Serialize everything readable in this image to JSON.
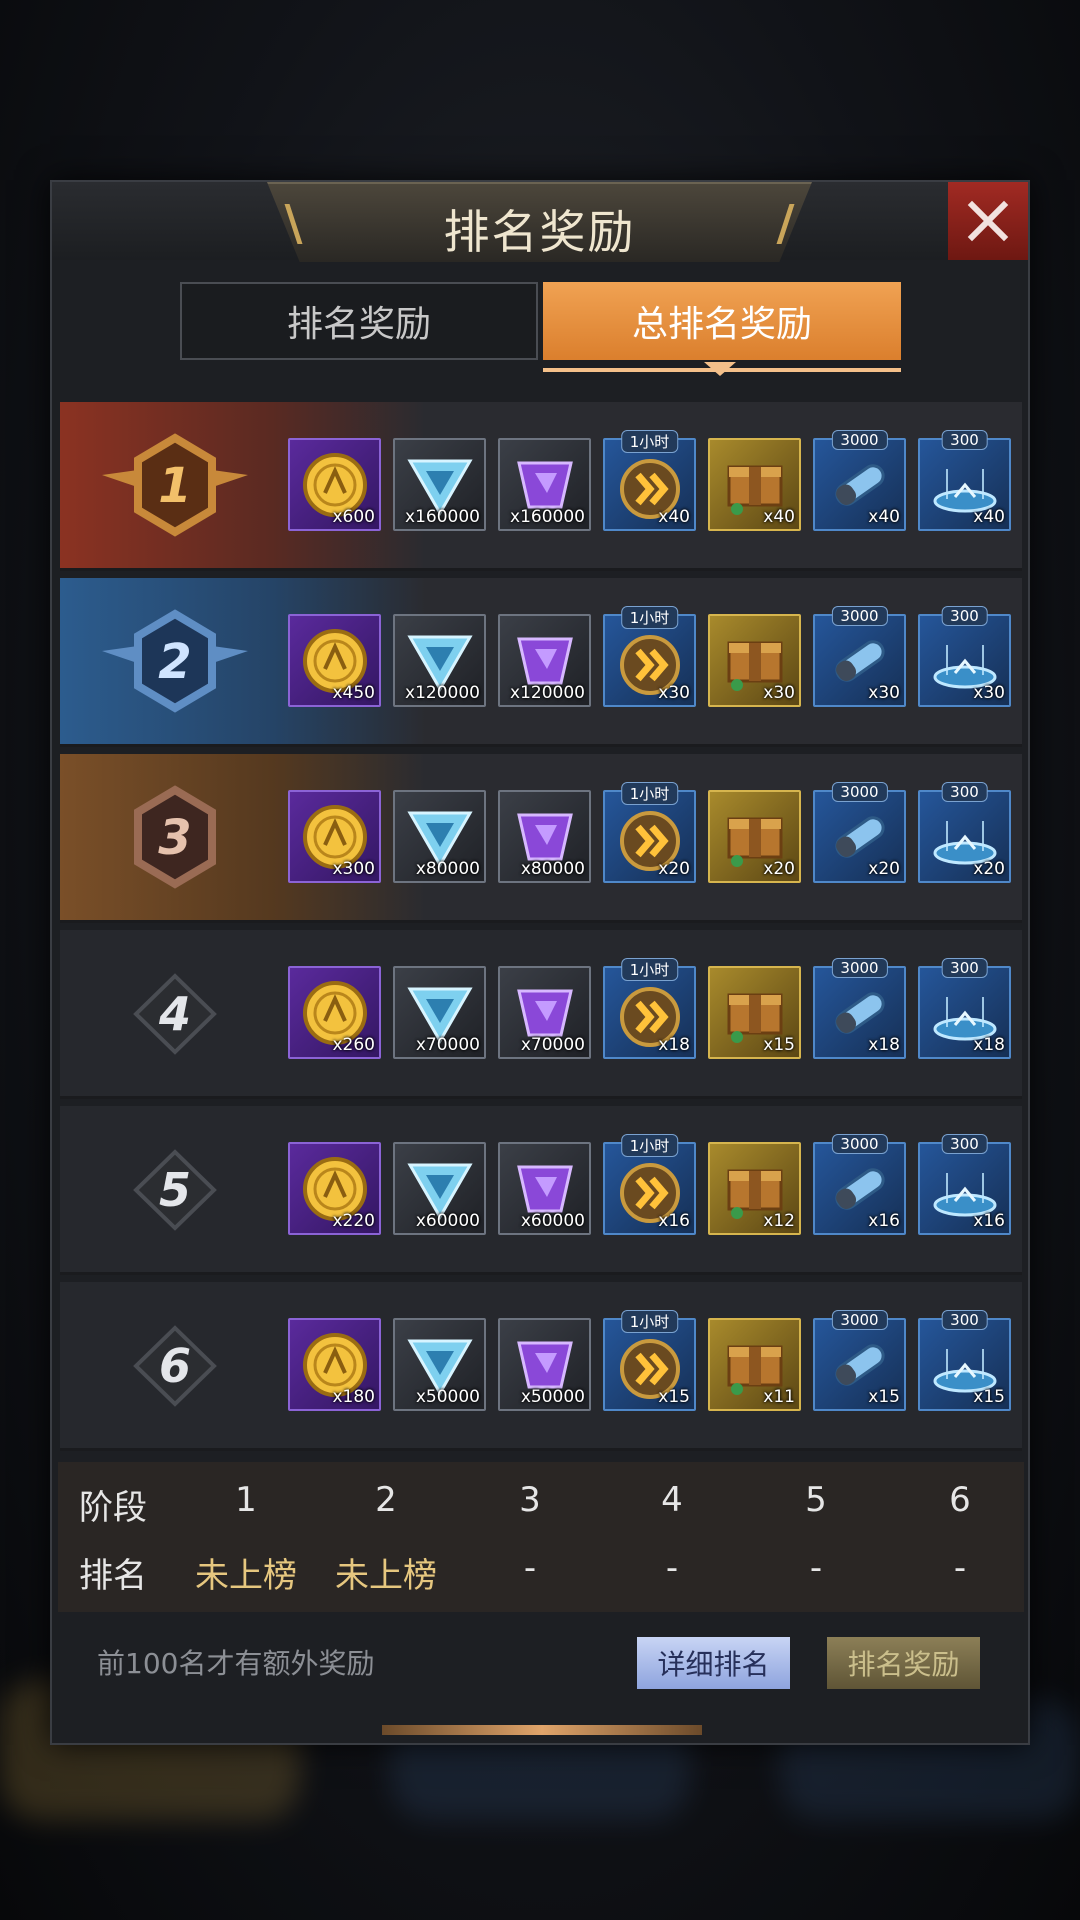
{
  "header": {
    "title": "排名奖励"
  },
  "tabs": [
    {
      "label": "排名奖励",
      "active": false
    },
    {
      "label": "总排名奖励",
      "active": true
    }
  ],
  "item_types": [
    {
      "icon": "gold-coin-icon",
      "frame": "purple"
    },
    {
      "icon": "blue-triangle-crystal-icon",
      "frame": "grey"
    },
    {
      "icon": "purple-gem-icon",
      "frame": "grey"
    },
    {
      "icon": "speedup-chevron-icon",
      "frame": "blue",
      "tag": "1小时"
    },
    {
      "icon": "supply-crate-icon",
      "frame": "gold"
    },
    {
      "icon": "blue-capsule-icon",
      "frame": "blue",
      "tag": "3000"
    },
    {
      "icon": "teleport-pad-icon",
      "frame": "blue",
      "tag": "300"
    }
  ],
  "rewards": [
    {
      "rank": "1",
      "items": [
        "x600",
        "x160000",
        "x160000",
        "x40",
        "x40",
        "x40",
        "x40"
      ]
    },
    {
      "rank": "2",
      "items": [
        "x450",
        "x120000",
        "x120000",
        "x30",
        "x30",
        "x30",
        "x30"
      ]
    },
    {
      "rank": "3",
      "items": [
        "x300",
        "x80000",
        "x80000",
        "x20",
        "x20",
        "x20",
        "x20"
      ]
    },
    {
      "rank": "4",
      "items": [
        "x260",
        "x70000",
        "x70000",
        "x18",
        "x15",
        "x18",
        "x18"
      ]
    },
    {
      "rank": "5",
      "items": [
        "x220",
        "x60000",
        "x60000",
        "x16",
        "x12",
        "x16",
        "x16"
      ]
    },
    {
      "rank": "6",
      "items": [
        "x180",
        "x50000",
        "x50000",
        "x15",
        "x11",
        "x15",
        "x15"
      ]
    }
  ],
  "stage_table": {
    "stage_label": "阶段",
    "rank_label": "排名",
    "stages": [
      "1",
      "2",
      "3",
      "4",
      "5",
      "6"
    ],
    "ranks": [
      "未上榜",
      "未上榜",
      "-",
      "-",
      "-",
      "-"
    ]
  },
  "footer": {
    "note": "前100名才有额外奖励",
    "detail_button": "详细排名",
    "reward_button": "排名奖励"
  }
}
